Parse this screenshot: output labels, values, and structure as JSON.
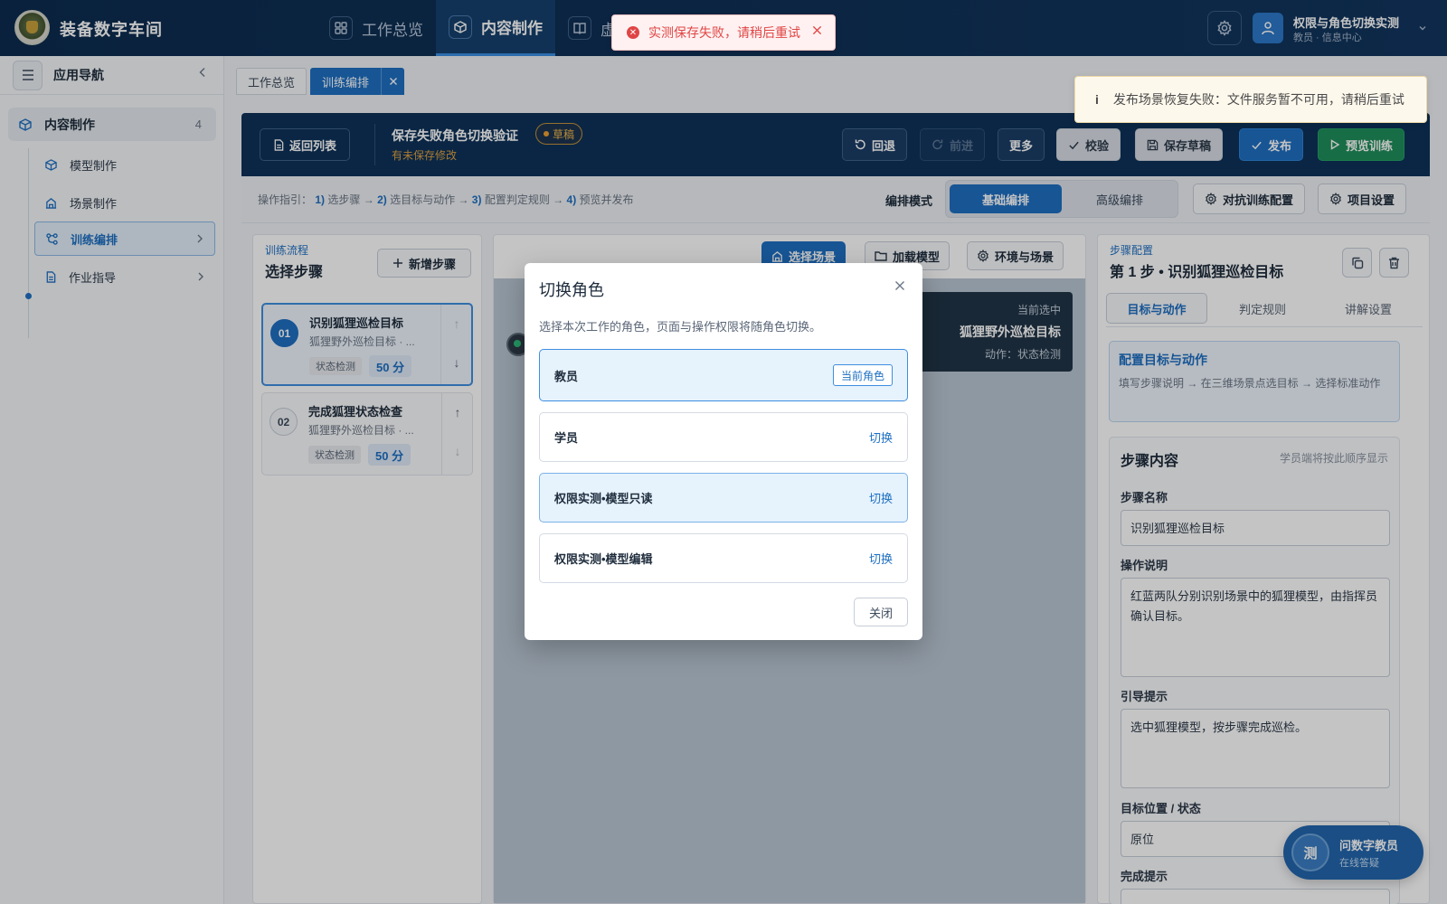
{
  "app": {
    "title": "装备数字车间"
  },
  "topnav": [
    {
      "label": "工作总览",
      "icon": "grid-icon"
    },
    {
      "label": "内容制作",
      "icon": "cube-icon"
    },
    {
      "label": "虚",
      "icon": "book-icon"
    }
  ],
  "user": {
    "name": "权限与角色切换实测",
    "role": "教员 · 信息中心"
  },
  "sidebar": {
    "title": "应用导航",
    "group": {
      "label": "内容制作",
      "count": "4"
    },
    "items": [
      {
        "label": "模型制作"
      },
      {
        "label": "场景制作"
      },
      {
        "label": "训练编排"
      },
      {
        "label": "作业指导"
      }
    ]
  },
  "tabs": [
    {
      "label": "工作总览"
    },
    {
      "label": "训练编排"
    }
  ],
  "toolbar": {
    "back": "返回列表",
    "title": "保存失败角色切换验证",
    "badge": "草稿",
    "subtitle": "有未保存修改",
    "undo": "回退",
    "redo": "前进",
    "more": "更多",
    "validate": "校验",
    "save_draft": "保存草稿",
    "publish": "发布",
    "preview": "预览训练"
  },
  "guide": {
    "prefix": "操作指引：",
    "s1n": "1)",
    "s1": "选步骤",
    "s2n": "2)",
    "s2": "选目标与动作",
    "s3n": "3)",
    "s3": "配置判定规则",
    "s4n": "4)",
    "s4": "预览并发布",
    "arrow": "→",
    "mode_label": "编排模式",
    "mode_basic": "基础编排",
    "mode_advanced": "高级编排",
    "confront": "对抗训练配置",
    "project": "项目设置"
  },
  "flow": {
    "kicker": "训练流程",
    "title": "选择步骤",
    "add": "新增步骤",
    "steps": [
      {
        "no": "01",
        "name": "识别狐狸巡检目标",
        "desc": "狐狸野外巡检目标 · ...",
        "tag": "状态检测",
        "score": "50 分"
      },
      {
        "no": "02",
        "name": "完成狐狸状态检查",
        "desc": "狐狸野外巡检目标 · ...",
        "tag": "状态检测",
        "score": "50 分"
      }
    ]
  },
  "scene": {
    "select": "选择场景",
    "load": "加载模型",
    "env": "环境与场景",
    "card_kicker": "当前选中",
    "card_title": "狐狸野外巡检目标",
    "card_action": "动作：状态检测"
  },
  "config": {
    "kicker": "步骤配置",
    "title": "第 1 步 • 识别狐狸巡检目标",
    "tabs": [
      "目标与动作",
      "判定规则",
      "讲解设置"
    ],
    "hint_title": "配置目标与动作",
    "hint_desc": "填写步骤说明 → 在三维场景点选目标 → 选择标准动作",
    "section": "步骤内容",
    "section_note": "学员端将按此顺序显示",
    "name_label": "步骤名称",
    "name_value": "识别狐狸巡检目标",
    "desc_label": "操作说明",
    "desc_value": "红蓝两队分别识别场景中的狐狸模型，由指挥员确认目标。",
    "guide_label": "引导提示",
    "guide_value": "选中狐狸模型，按步骤完成巡检。",
    "pos_label": "目标位置 / 状态",
    "pos_value": "原位",
    "done_label": "完成提示"
  },
  "assistant": {
    "avatar": "测",
    "name": "问数字教员",
    "status": "在线答疑"
  },
  "modal": {
    "title": "切换角色",
    "desc": "选择本次工作的角色，页面与操作权限将随角色切换。",
    "roles": [
      {
        "name": "教员",
        "action": "当前角色"
      },
      {
        "name": "学员",
        "action": "切换"
      },
      {
        "name": "权限实测•模型只读",
        "action": "切换"
      },
      {
        "name": "权限实测•模型编辑",
        "action": "切换"
      }
    ],
    "close": "关闭"
  },
  "toasts": {
    "error": "实测保存失败，请稍后重试",
    "info": "发布场景恢复失败：文件服务暂不可用，请稍后重试"
  },
  "colors": {
    "primary": "#1e6fc2",
    "header": "#0e3259",
    "success": "#1f8e5a",
    "danger": "#e04545",
    "warning": "#f0a030"
  }
}
